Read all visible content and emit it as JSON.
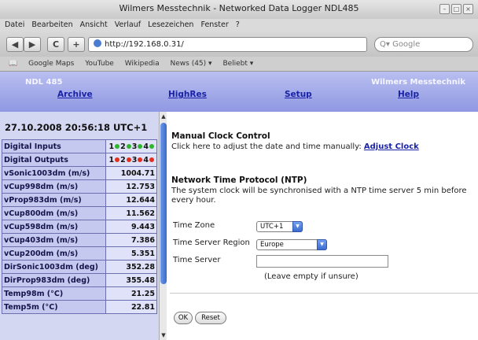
{
  "window": {
    "title": "Wilmers Messtechnik - Networked Data Logger NDL485"
  },
  "menu": [
    "Datei",
    "Bearbeiten",
    "Ansicht",
    "Verlauf",
    "Lesezeichen",
    "Fenster",
    "?"
  ],
  "navigation": {
    "back": "◀",
    "forward": "▶",
    "reload": "C",
    "add": "+",
    "url": "http://192.168.0.31/",
    "search_placeholder": "Q▾ Google"
  },
  "bookmarks": [
    "Google Maps",
    "YouTube",
    "Wikipedia",
    "News (45) ▾",
    "Beliebt ▾"
  ],
  "banner": {
    "device": "NDL 485",
    "company": "Wilmers Messtechnik",
    "links": [
      "Archive",
      "HighRes",
      "Setup",
      "Help"
    ]
  },
  "sidebar": {
    "datetime": "27.10.2008 20:56:18 UTC+1",
    "digital_inputs": {
      "label": "Digital Inputs",
      "channels": [
        {
          "num": "1",
          "color": "#2fb62f"
        },
        {
          "num": "2",
          "color": "#2fb62f"
        },
        {
          "num": "3",
          "color": "#2fb62f"
        },
        {
          "num": "4",
          "color": "#2fb62f"
        }
      ]
    },
    "digital_outputs": {
      "label": "Digital Outputs",
      "channels": [
        {
          "num": "1",
          "color": "#e0301e"
        },
        {
          "num": "2",
          "color": "#e0301e"
        },
        {
          "num": "3",
          "color": "#e0301e"
        },
        {
          "num": "4",
          "color": "#e0301e"
        }
      ]
    },
    "measurements": [
      {
        "label": "vSonic1003dm (m/s)",
        "value": "1004.71"
      },
      {
        "label": "vCup998dm (m/s)",
        "value": "12.753"
      },
      {
        "label": "vProp983dm (m/s)",
        "value": "12.644"
      },
      {
        "label": "vCup800dm (m/s)",
        "value": "11.562"
      },
      {
        "label": "vCup598dm (m/s)",
        "value": "9.443"
      },
      {
        "label": "vCup403dm (m/s)",
        "value": "7.386"
      },
      {
        "label": "vCup200dm (m/s)",
        "value": "5.351"
      },
      {
        "label": "DirSonic1003dm (deg)",
        "value": "352.28"
      },
      {
        "label": "DirProp983dm (deg)",
        "value": "355.48"
      },
      {
        "label": "Temp98m (°C)",
        "value": "21.25"
      },
      {
        "label": "Temp5m (°C)",
        "value": "22.81"
      }
    ]
  },
  "main": {
    "manual_title": "Manual Clock Control",
    "manual_text": "Click here to adjust the date and time manually:",
    "manual_link": "Adjust Clock",
    "ntp_title": "Network Time Protocol (NTP)",
    "ntp_text_1": "The system clock will be synchronised with a NTP time server 5 min before",
    "ntp_text_2": "every hour.",
    "timezone_label": "Time Zone",
    "timezone_value": "UTC+1",
    "region_label": "Time Server Region",
    "region_value": "Europe",
    "server_label": "Time Server",
    "server_value": "",
    "server_hint": "(Leave empty if unsure)",
    "ok_label": "OK",
    "reset_label": "Reset"
  },
  "colors": {
    "banner_top": "#b9bff0",
    "banner_bottom": "#8f98e2",
    "link": "#1a22a8",
    "sidebar_bg": "#d4d7f2"
  }
}
